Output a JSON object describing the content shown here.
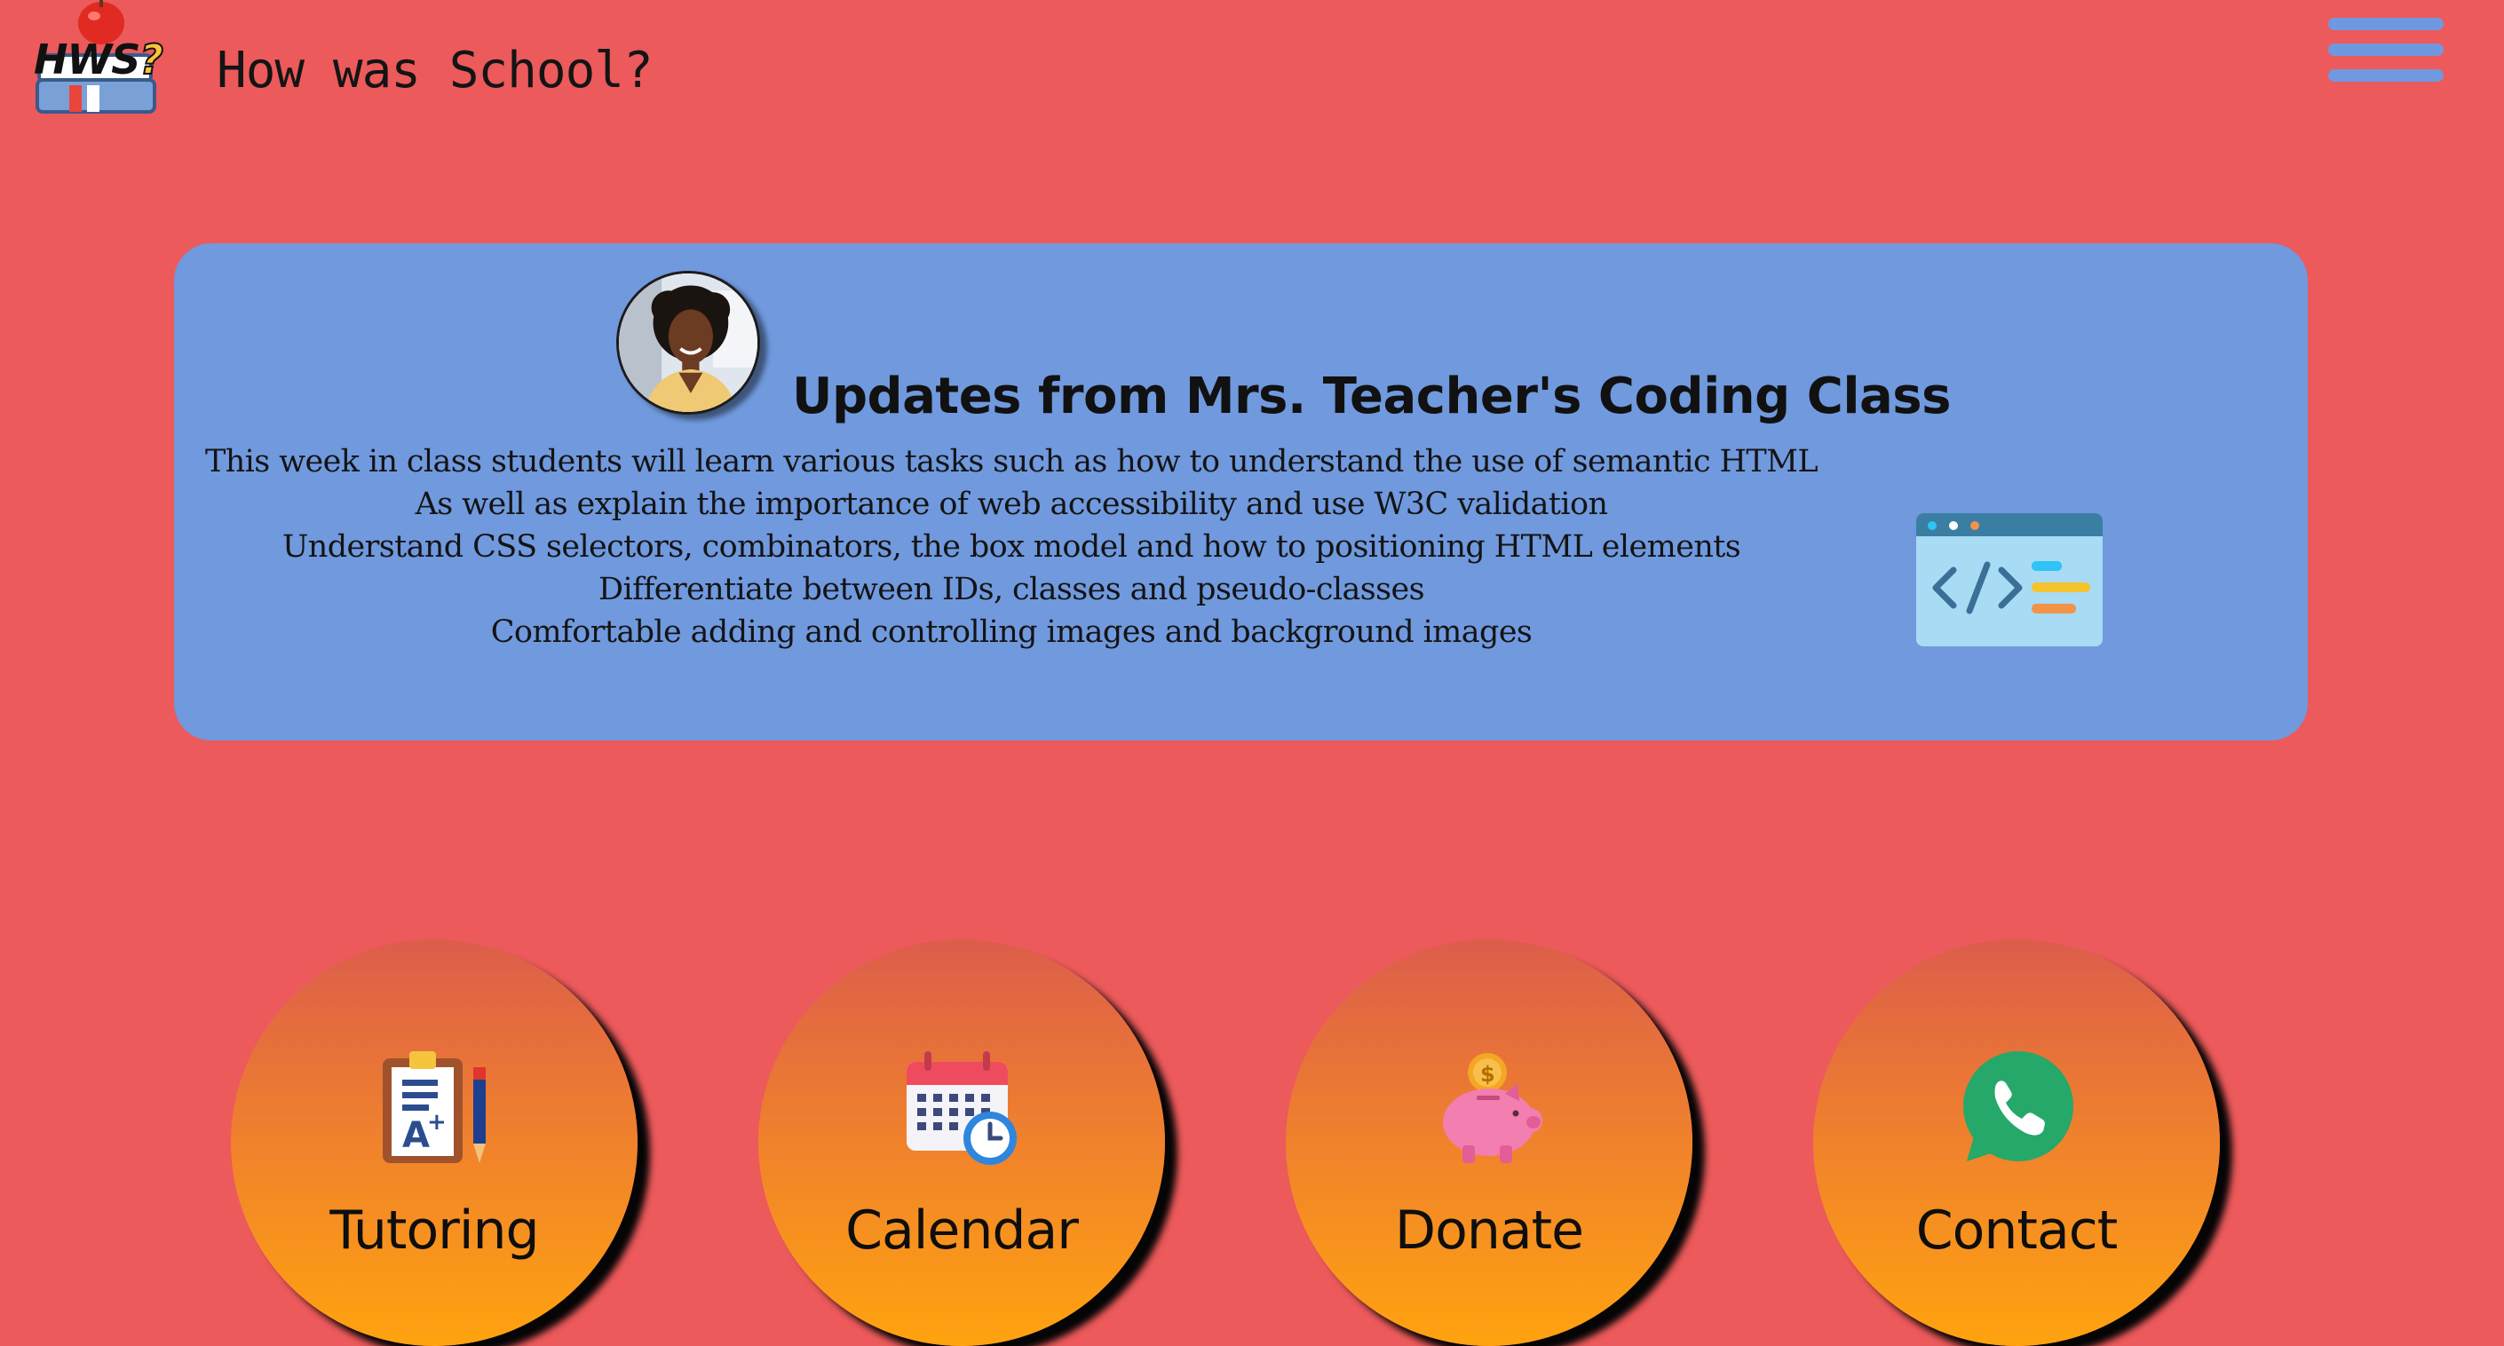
{
  "header": {
    "logo_text": "HWS",
    "logo_mark": "?",
    "title": "How was School?",
    "menu_icon": "hamburger-menu-icon"
  },
  "updates": {
    "title": "Updates from Mrs. Teacher's Coding Class",
    "avatar": "teacher-portrait",
    "lines": [
      "This week in class students will learn various tasks such as how to understand the use of semantic HTML",
      "As well as explain the importance of web accessibility and use W3C validation",
      "Understand CSS selectors, combinators, the box model and how to positioning HTML elements",
      "Differentiate between IDs, classes and pseudo-classes",
      "Comfortable adding and controlling images and background images"
    ],
    "side_icon": "code-window-icon"
  },
  "nav": [
    {
      "label": "Tutoring",
      "icon": "clipboard-grade-icon"
    },
    {
      "label": "Calendar",
      "icon": "calendar-clock-icon"
    },
    {
      "label": "Donate",
      "icon": "piggy-bank-icon"
    },
    {
      "label": "Contact",
      "icon": "whatsapp-phone-icon"
    }
  ],
  "colors": {
    "background": "#ec5a5b",
    "card": "#7099de",
    "menu": "#7098e0",
    "circle_top": "#dc5d4b",
    "circle_bottom": "#ffa30f"
  }
}
